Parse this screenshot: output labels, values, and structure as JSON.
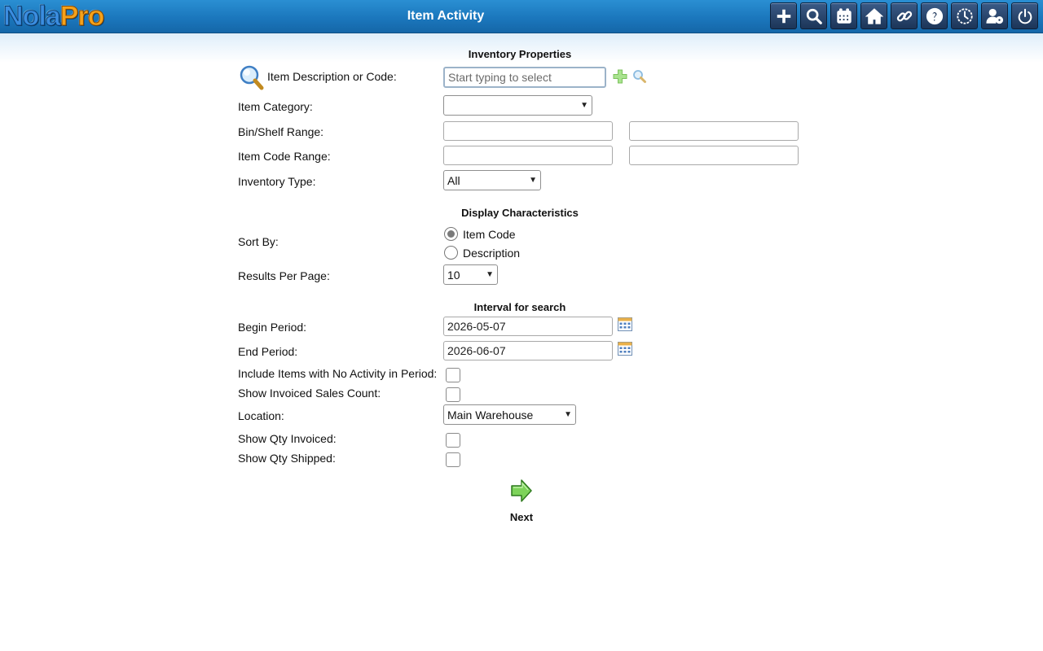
{
  "app": {
    "logo_part1": "Nola",
    "logo_part2": "Pro",
    "page_title": "Item Activity"
  },
  "toolbar": [
    {
      "name": "add-icon"
    },
    {
      "name": "search-icon"
    },
    {
      "name": "calendar-icon"
    },
    {
      "name": "home-icon"
    },
    {
      "name": "link-icon"
    },
    {
      "name": "help-icon"
    },
    {
      "name": "clock-icon"
    },
    {
      "name": "user-settings-icon"
    },
    {
      "name": "power-icon"
    }
  ],
  "inventory": {
    "title": "Inventory Properties",
    "item_label": "Item Description or Code:",
    "item_placeholder": "Start typing to select",
    "category_label": "Item Category:",
    "category_value": "",
    "bin_label": "Bin/Shelf Range:",
    "bin_from": "",
    "bin_to": "",
    "code_label": "Item Code Range:",
    "code_from": "",
    "code_to": "",
    "type_label": "Inventory Type:",
    "type_value": "All"
  },
  "display": {
    "title": "Display Characteristics",
    "sort_label": "Sort By:",
    "sort_options": [
      "Item Code",
      "Description"
    ],
    "sort_selected": "Item Code",
    "results_label": "Results Per Page:",
    "results_value": "10"
  },
  "interval": {
    "title": "Interval for search",
    "begin_label": "Begin Period:",
    "begin_value": "2026-05-07",
    "end_label": "End Period:",
    "end_value": "2026-06-07",
    "no_activity_label": "Include Items with No Activity in Period:",
    "invoiced_count_label": "Show Invoiced Sales Count:",
    "location_label": "Location:",
    "location_value": "Main Warehouse",
    "qty_invoiced_label": "Show Qty Invoiced:",
    "qty_shipped_label": "Show Qty Shipped:"
  },
  "actions": {
    "next_label": "Next"
  },
  "colors": {
    "header": "#1b77bd",
    "toolbar_button": "#1c3558",
    "next_arrow": "#6cc24a"
  }
}
